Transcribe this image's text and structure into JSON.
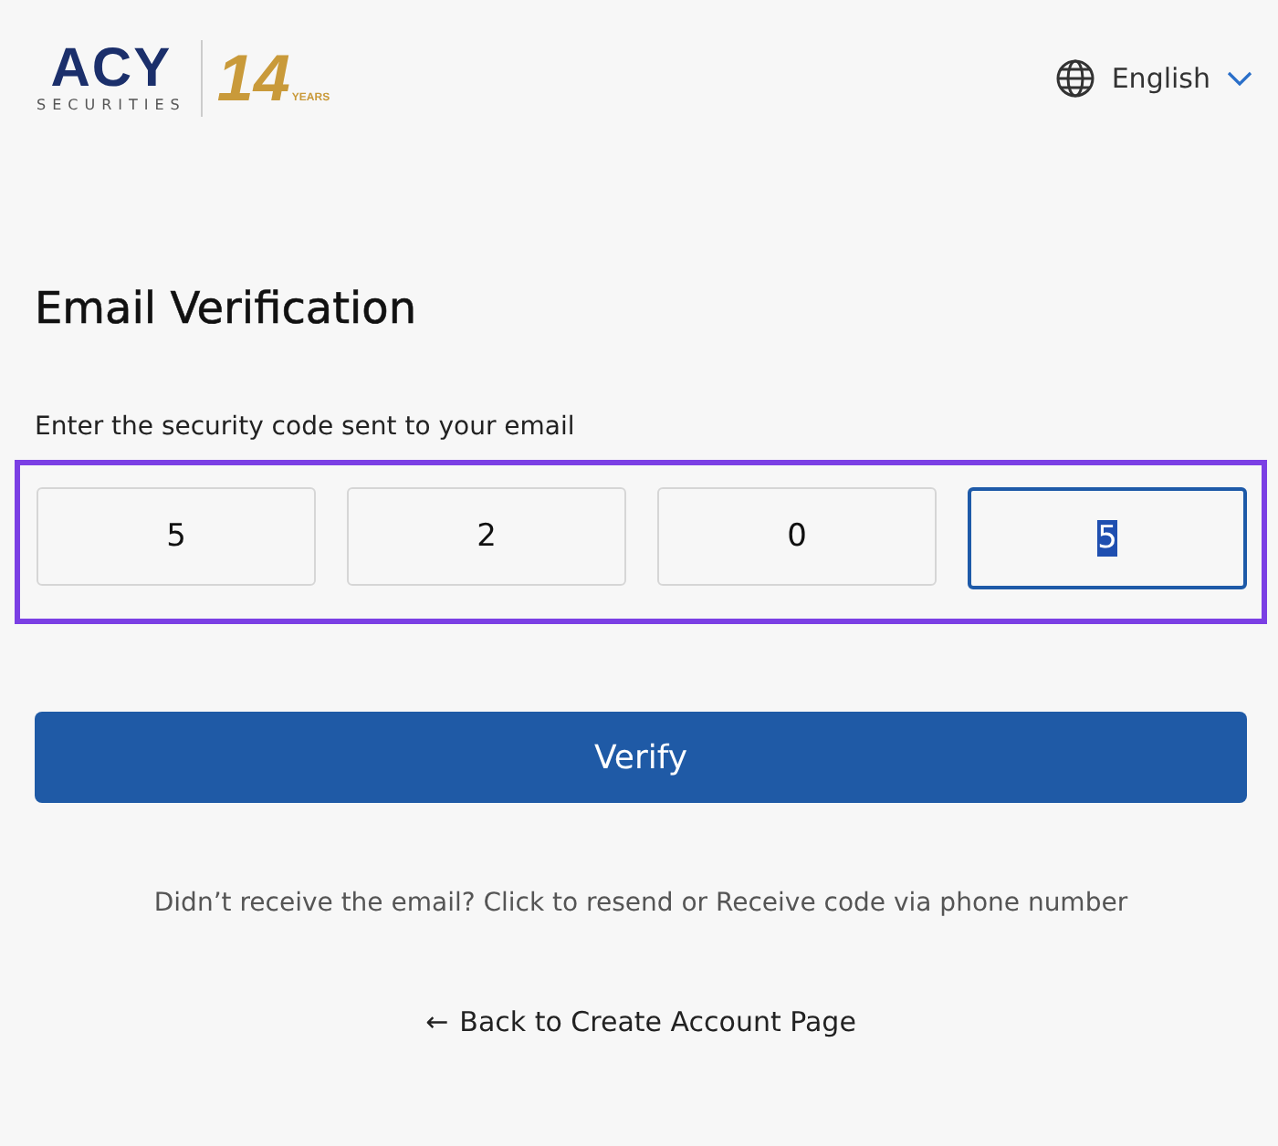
{
  "header": {
    "logo": {
      "brand": "ACY",
      "tagline": "SECURITIES",
      "anniversary": "14",
      "anniversary_unit": "YEARS"
    },
    "language": {
      "label": "English"
    }
  },
  "title": "Email Verification",
  "code_entry": {
    "label": "Enter the security code sent to your email",
    "highlighted": true,
    "digits": [
      {
        "value": "5",
        "focused": false
      },
      {
        "value": "2",
        "focused": false
      },
      {
        "value": "0",
        "focused": false
      },
      {
        "value": "5",
        "focused": true
      }
    ]
  },
  "verify_button": "Verify",
  "resend_text": "Didn’t receive the email? Click to resend or Receive code via phone number",
  "back_link": {
    "arrow": "←",
    "label": "Back to Create Account Page"
  }
}
